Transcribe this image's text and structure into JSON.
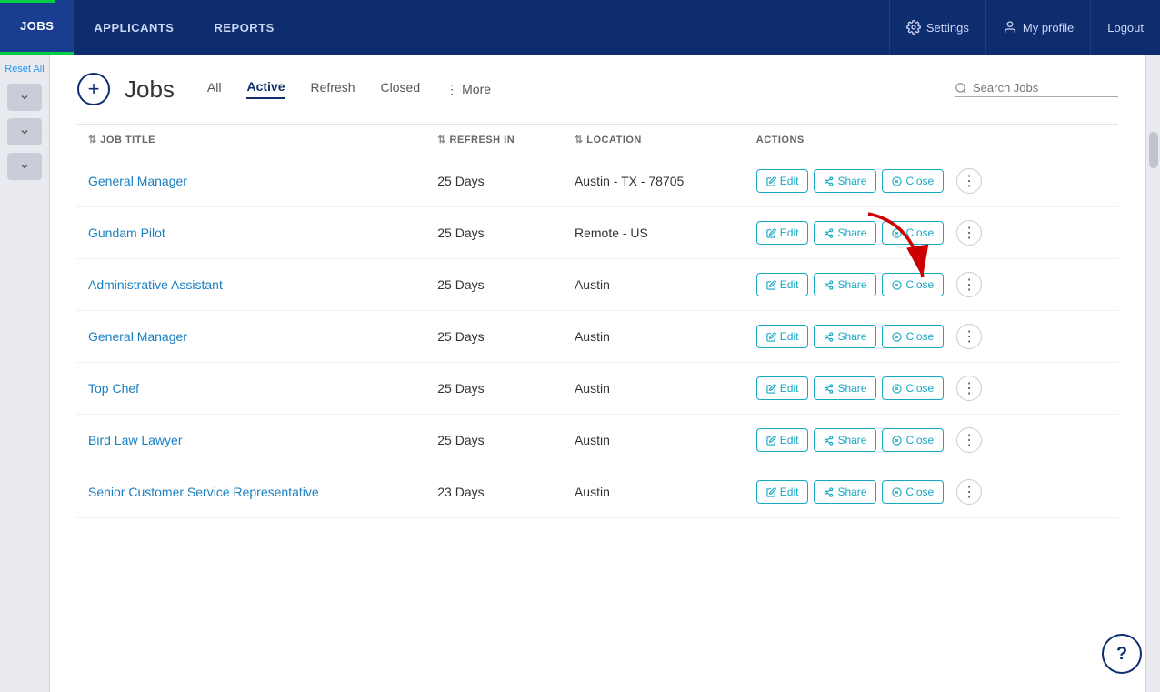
{
  "nav": {
    "items": [
      {
        "label": "JOBS",
        "active": true
      },
      {
        "label": "APPLICANTS",
        "active": false
      },
      {
        "label": "REPORTS",
        "active": false
      }
    ],
    "right_items": [
      {
        "label": "Settings",
        "icon": "gear"
      },
      {
        "label": "My profile",
        "icon": "user"
      },
      {
        "label": "Logout",
        "icon": null
      }
    ]
  },
  "sidebar": {
    "reset_label": "Reset All"
  },
  "jobs_header": {
    "add_icon": "+",
    "title": "Jobs",
    "tabs": [
      {
        "label": "All",
        "active": false
      },
      {
        "label": "Active",
        "active": true
      },
      {
        "label": "Refresh",
        "active": false
      },
      {
        "label": "Closed",
        "active": false
      },
      {
        "label": "More",
        "active": false
      }
    ],
    "search_placeholder": "Search Jobs"
  },
  "table": {
    "columns": [
      {
        "label": "JOB TITLE",
        "sortable": true
      },
      {
        "label": "REFRESH IN",
        "sortable": true
      },
      {
        "label": "LOCATION",
        "sortable": true
      },
      {
        "label": "ACTIONS",
        "sortable": false
      }
    ],
    "rows": [
      {
        "title": "General Manager",
        "refresh_in": "25 Days",
        "location": "Austin - TX - 78705",
        "actions": [
          "Edit",
          "Share",
          "Close"
        ]
      },
      {
        "title": "Gundam Pilot",
        "refresh_in": "25 Days",
        "location": "Remote - US",
        "actions": [
          "Edit",
          "Share",
          "Close"
        ]
      },
      {
        "title": "Administrative Assistant",
        "refresh_in": "25 Days",
        "location": "Austin",
        "actions": [
          "Edit",
          "Share",
          "Close"
        ]
      },
      {
        "title": "General Manager",
        "refresh_in": "25 Days",
        "location": "Austin",
        "actions": [
          "Edit",
          "Share",
          "Close"
        ]
      },
      {
        "title": "Top Chef",
        "refresh_in": "25 Days",
        "location": "Austin",
        "actions": [
          "Edit",
          "Share",
          "Close"
        ]
      },
      {
        "title": "Bird Law Lawyer",
        "refresh_in": "25 Days",
        "location": "Austin",
        "actions": [
          "Edit",
          "Share",
          "Close"
        ]
      },
      {
        "title": "Senior Customer Service Representative",
        "refresh_in": "23 Days",
        "location": "Austin",
        "actions": [
          "Edit",
          "Share",
          "Close"
        ]
      }
    ]
  },
  "actions": {
    "edit_label": "Edit",
    "share_label": "Share",
    "close_label": "Close"
  }
}
